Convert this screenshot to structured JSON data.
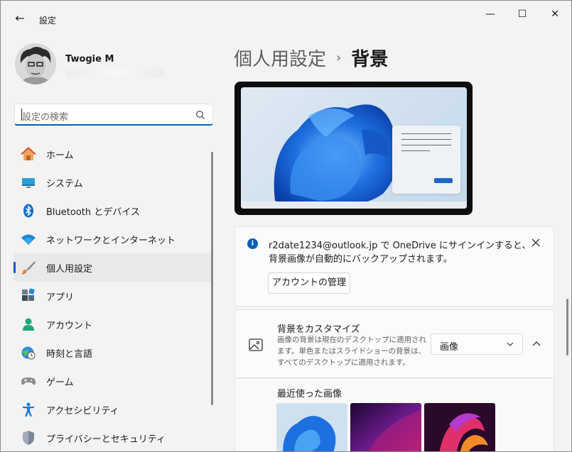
{
  "window": {
    "title": "設定",
    "back_glyph": "←",
    "minimize_glyph": "—",
    "maximize_glyph": "☐",
    "close_glyph": "✕"
  },
  "profile": {
    "name": "Twogie M"
  },
  "search": {
    "placeholder": "設定の検索"
  },
  "sidebar": {
    "items": [
      {
        "label": "ホーム",
        "icon": "home-icon"
      },
      {
        "label": "システム",
        "icon": "monitor-icon"
      },
      {
        "label": "Bluetooth とデバイス",
        "icon": "bluetooth-icon"
      },
      {
        "label": "ネットワークとインターネット",
        "icon": "wifi-icon"
      },
      {
        "label": "個人用設定",
        "icon": "brush-icon",
        "selected": true
      },
      {
        "label": "アプリ",
        "icon": "apps-icon"
      },
      {
        "label": "アカウント",
        "icon": "person-icon"
      },
      {
        "label": "時刻と言語",
        "icon": "clock-globe-icon"
      },
      {
        "label": "ゲーム",
        "icon": "gamepad-icon"
      },
      {
        "label": "アクセシビリティ",
        "icon": "accessibility-icon"
      },
      {
        "label": "プライバシーとセキュリティ",
        "icon": "shield-icon"
      }
    ]
  },
  "breadcrumb": {
    "parent": "個人用設定",
    "separator": "›",
    "current": "背景"
  },
  "infobar": {
    "line1": "r2date1234@outlook.jp で OneDrive にサインインすると、",
    "line2": "背景画像が自動的にバックアップされます。",
    "button_label": "アカウントの管理"
  },
  "customize": {
    "title": "背景をカスタマイズ",
    "description": "画像の背景は現在のデスクトップに適用されます。単色またはスライドショーの背景は、すべてのデスクトップに適用されます。",
    "dropdown_value": "画像"
  },
  "recent": {
    "title": "最近使った画像"
  },
  "colors": {
    "accent": "#005fb8",
    "background": "#f3f3f3",
    "card": "#fbfbfb"
  }
}
